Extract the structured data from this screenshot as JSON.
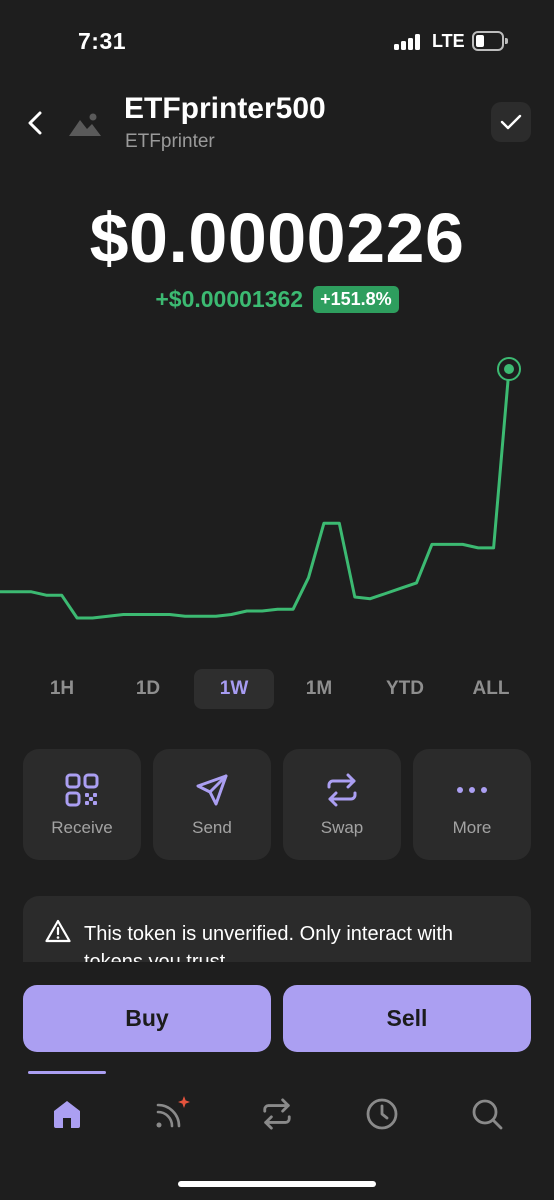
{
  "status_bar": {
    "time": "7:31",
    "network": "LTE"
  },
  "header": {
    "back_icon": "chevron-left-icon",
    "avatar_icon": "image-placeholder-icon",
    "token_name": "ETFprinter500",
    "token_symbol": "ETFprinter",
    "verify_icon": "check-icon"
  },
  "price": {
    "value": "$0.0000226",
    "change_value": "+$0.00001362",
    "change_percent": "+151.8%",
    "positive_color": "#3cba72"
  },
  "chart_data": {
    "type": "line",
    "color": "#3cba72",
    "y": [
      9.9e-06,
      9.9e-06,
      9.9e-06,
      9.7e-06,
      9.7e-06,
      8.4e-06,
      8.4e-06,
      8.5e-06,
      8.6e-06,
      8.6e-06,
      8.6e-06,
      8.6e-06,
      8.5e-06,
      8.5e-06,
      8.5e-06,
      8.6e-06,
      8.8e-06,
      8.8e-06,
      8.9e-06,
      8.9e-06,
      1.07e-05,
      1.38e-05,
      1.38e-05,
      9.6e-06,
      9.5e-06,
      9.8e-06,
      1.01e-05,
      1.04e-05,
      1.26e-05,
      1.26e-05,
      1.26e-05,
      1.24e-05,
      1.24e-05,
      2.26e-05
    ],
    "final_point_marker": true
  },
  "range_tabs": {
    "items": [
      "1H",
      "1D",
      "1W",
      "1M",
      "YTD",
      "ALL"
    ],
    "selected": "1W"
  },
  "actions": {
    "receive": "Receive",
    "send": "Send",
    "swap": "Swap",
    "more": "More"
  },
  "warning": {
    "text": "This token is unverified. Only interact with tokens you trust."
  },
  "trade": {
    "buy": "Buy",
    "sell": "Sell"
  },
  "tab_bar": {
    "items": [
      "home-icon",
      "activity-feed-icon",
      "swap-icon",
      "history-icon",
      "search-icon"
    ],
    "selected": "home-icon",
    "accent": "#ab9ff2",
    "notification_dot_color": "#e5533d"
  }
}
